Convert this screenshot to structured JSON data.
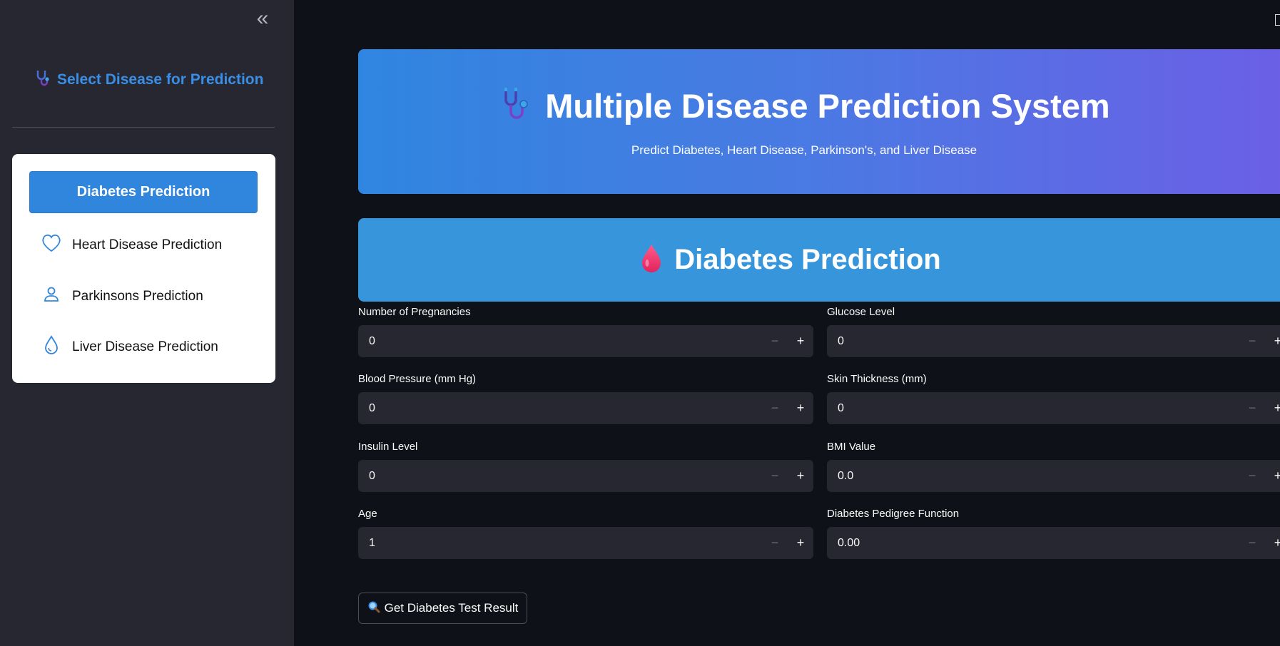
{
  "sidebar": {
    "collapse_label": "«",
    "title": "Select Disease for Prediction",
    "menu": [
      {
        "label": "Diabetes Prediction",
        "icon": "droplet-icon",
        "active": true
      },
      {
        "label": "Heart Disease Prediction",
        "icon": "heart-icon"
      },
      {
        "label": "Parkinsons Prediction",
        "icon": "person-icon"
      },
      {
        "label": "Liver Disease Prediction",
        "icon": "droplet-icon"
      }
    ]
  },
  "banner": {
    "title": "Multiple Disease Prediction System",
    "subtitle": "Predict Diabetes, Heart Disease, Parkinson's, and Liver Disease"
  },
  "section": {
    "title": "Diabetes Prediction"
  },
  "fields": [
    {
      "label": "Number of Pregnancies",
      "value": "0"
    },
    {
      "label": "Glucose Level",
      "value": "0"
    },
    {
      "label": "Blood Pressure (mm Hg)",
      "value": "0"
    },
    {
      "label": "Skin Thickness (mm)",
      "value": "0"
    },
    {
      "label": "Insulin Level",
      "value": "0"
    },
    {
      "label": "BMI Value",
      "value": "0.0"
    },
    {
      "label": "Age",
      "value": "1"
    },
    {
      "label": "Diabetes Pedigree Function",
      "value": "0.00"
    }
  ],
  "stepper": {
    "minus": "−",
    "plus": "+"
  },
  "result_button": {
    "label": "Get Diabetes Test Result",
    "icon": "magnifier-icon"
  },
  "colors": {
    "accent": "#2f86dc",
    "banner_start": "#2f86e0",
    "banner_end": "#6b5fe6",
    "section": "#3796db"
  }
}
